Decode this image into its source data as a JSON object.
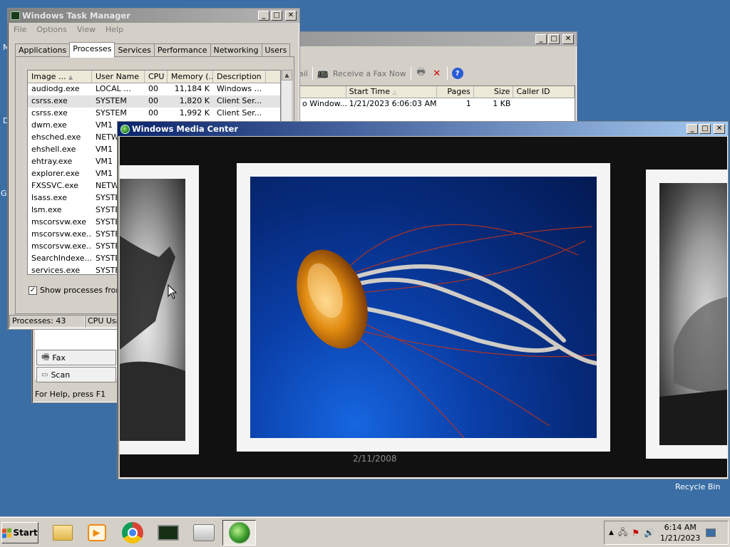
{
  "desktop": {
    "left_label_1": "M",
    "left_label_2": "D",
    "left_label_3": "G",
    "recycle_bin": "Recycle Bin"
  },
  "fax": {
    "toolbar": {
      "email_fragment": "ail",
      "receive_label": "Receive a Fax Now"
    },
    "columns": {
      "from_fragment": "",
      "start_time": "Start Time",
      "pages": "Pages",
      "size": "Size",
      "caller_id": "Caller ID"
    },
    "row": {
      "from": "o Window...",
      "start_time": "1/21/2023 6:06:03 AM",
      "pages": "1",
      "size": "1 KB",
      "caller_id": ""
    },
    "folders": {
      "fax": "Fax",
      "scan": "Scan"
    },
    "status": "For Help, press F1"
  },
  "task_manager": {
    "title": "Windows Task Manager",
    "menu": [
      "File",
      "Options",
      "View",
      "Help"
    ],
    "tabs": [
      "Applications",
      "Processes",
      "Services",
      "Performance",
      "Networking",
      "Users"
    ],
    "columns": {
      "image": "Image ...",
      "user": "User Name",
      "cpu": "CPU",
      "memory": "Memory (...",
      "description": "Description"
    },
    "processes": [
      {
        "image": "audiodg.exe",
        "user": "LOCAL ...",
        "cpu": "00",
        "memory": "11,184 K",
        "description": "Windows ..."
      },
      {
        "image": "csrss.exe",
        "user": "SYSTEM",
        "cpu": "00",
        "memory": "1,820 K",
        "description": "Client Ser..."
      },
      {
        "image": "csrss.exe",
        "user": "SYSTEM",
        "cpu": "00",
        "memory": "1,992 K",
        "description": "Client Ser..."
      },
      {
        "image": "dwm.exe",
        "user": "VM1",
        "cpu": "",
        "memory": "",
        "description": ""
      },
      {
        "image": "ehsched.exe",
        "user": "NETW",
        "cpu": "",
        "memory": "",
        "description": ""
      },
      {
        "image": "ehshell.exe",
        "user": "VM1",
        "cpu": "",
        "memory": "",
        "description": ""
      },
      {
        "image": "ehtray.exe",
        "user": "VM1",
        "cpu": "",
        "memory": "",
        "description": ""
      },
      {
        "image": "explorer.exe",
        "user": "VM1",
        "cpu": "",
        "memory": "",
        "description": ""
      },
      {
        "image": "FXSSVC.exe",
        "user": "NETW",
        "cpu": "",
        "memory": "",
        "description": ""
      },
      {
        "image": "lsass.exe",
        "user": "SYSTE",
        "cpu": "",
        "memory": "",
        "description": ""
      },
      {
        "image": "lsm.exe",
        "user": "SYSTE",
        "cpu": "",
        "memory": "",
        "description": ""
      },
      {
        "image": "mscorsvw.exe",
        "user": "SYSTE",
        "cpu": "",
        "memory": "",
        "description": ""
      },
      {
        "image": "mscorsvw.exe...",
        "user": "SYSTE",
        "cpu": "",
        "memory": "",
        "description": ""
      },
      {
        "image": "mscorsvw.exe...",
        "user": "SYSTE",
        "cpu": "",
        "memory": "",
        "description": ""
      },
      {
        "image": "SearchIndexe...",
        "user": "SYSTE",
        "cpu": "",
        "memory": "",
        "description": ""
      },
      {
        "image": "services.exe",
        "user": "SYSTE",
        "cpu": "",
        "memory": "",
        "description": ""
      }
    ],
    "show_all_label": "Show processes from a",
    "status": {
      "processes": "Processes: 43",
      "cpu": "CPU Usa"
    }
  },
  "media_center": {
    "title": "Windows Media Center",
    "photo_date": "2/11/2008"
  },
  "taskbar": {
    "start_label": "Start",
    "clock_time": "6:14 AM",
    "clock_date": "1/21/2023"
  },
  "colors": {
    "desktop": "#3a6ea5",
    "active_title_start": "#0a246a",
    "active_title_end": "#a6caf0",
    "inactive_title_start": "#808080",
    "inactive_title_end": "#b5b5b5"
  }
}
